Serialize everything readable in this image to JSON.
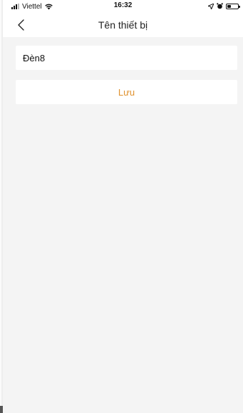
{
  "status_bar": {
    "carrier": "Viettel",
    "time": "16:32",
    "icons": [
      "signal-icon",
      "wifi-icon",
      "location-icon",
      "alarm-icon",
      "battery-icon"
    ]
  },
  "navbar": {
    "title": "Tên thiết bị",
    "back_icon": "chevron-left-icon"
  },
  "form": {
    "device_name_value": "Đèn8",
    "save_label": "Lưu"
  },
  "colors": {
    "accent": "#e0922f",
    "background": "#f4f4f4",
    "surface": "#ffffff"
  }
}
